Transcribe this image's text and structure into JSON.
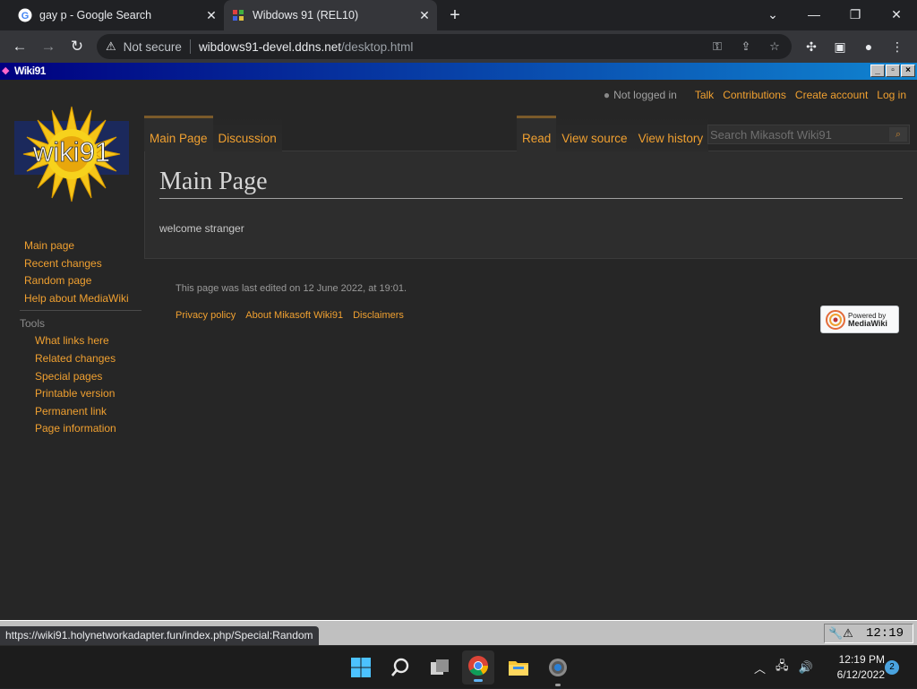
{
  "browser": {
    "tabs": [
      {
        "title": "gay p - Google Search",
        "favicon": "google-icon"
      },
      {
        "title": "Wibdows 91 (REL10)",
        "favicon": "wibdows-icon"
      }
    ],
    "omnibox": {
      "security_label": "Not secure",
      "host": "wibdows91-devel.ddns.net",
      "path": "/desktop.html"
    },
    "status_url": "https://wiki91.holynetworkadapter.fun/index.php/Special:Random"
  },
  "w91": {
    "window_title": "Wiki91",
    "tray_clock": "12:19"
  },
  "wiki": {
    "personal": {
      "not_logged_in": "Not logged in",
      "talk": "Talk",
      "contributions": "Contributions",
      "create_account": "Create account",
      "log_in": "Log in"
    },
    "logo_text": "wiki91",
    "tabs_left": [
      "Main Page",
      "Discussion"
    ],
    "tabs_right": [
      "Read",
      "View source",
      "View history"
    ],
    "search_placeholder": "Search Mikasoft Wiki91",
    "page_title": "Main Page",
    "body_text": "welcome stranger",
    "navigation": [
      "Main page",
      "Recent changes",
      "Random page",
      "Help about MediaWiki"
    ],
    "tools_heading": "Tools",
    "tools": [
      "What links here",
      "Related changes",
      "Special pages",
      "Printable version",
      "Permanent link",
      "Page information"
    ],
    "footer_info": "This page was last edited on 12 June 2022, at 19:01.",
    "footer_links": [
      "Privacy policy",
      "About Mikasoft Wiki91",
      "Disclaimers"
    ],
    "powered_by": {
      "line1": "Powered by",
      "line2": "MediaWiki"
    }
  },
  "os": {
    "clock_time": "12:19 PM",
    "clock_date": "6/12/2022",
    "notification_count": "2"
  },
  "colors": {
    "link": "#f0a030",
    "page_bg": "#262626",
    "content_bg": "#2d2d2d"
  }
}
